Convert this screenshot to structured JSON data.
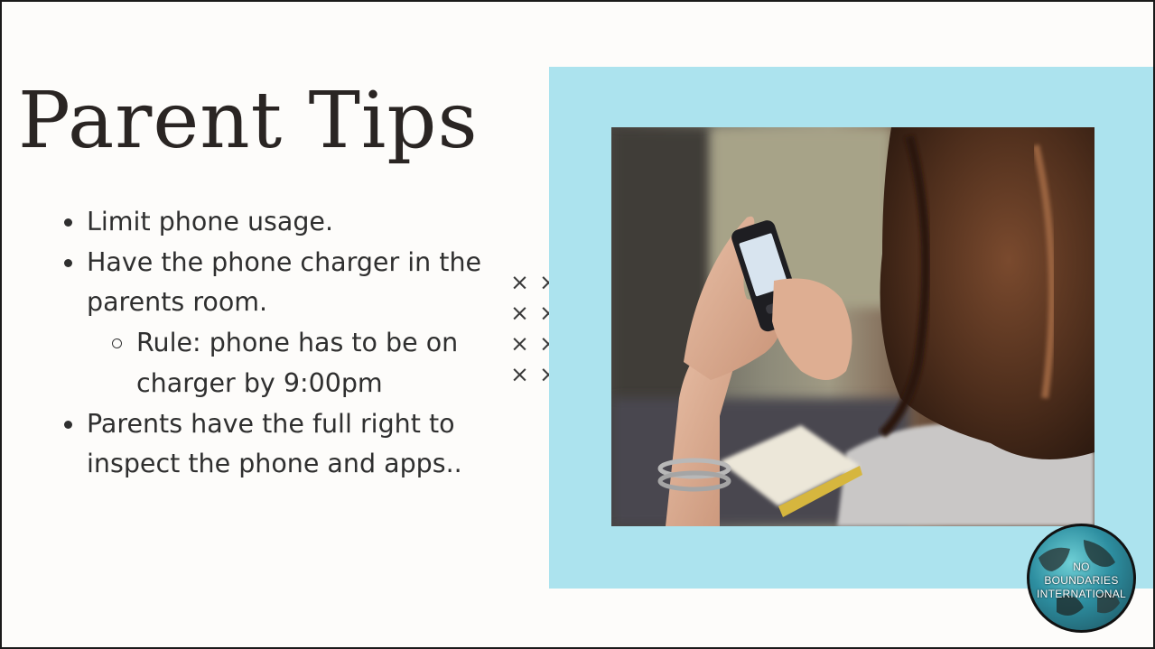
{
  "slide": {
    "title": "Parent Tips",
    "bullets": [
      "Limit phone usage.",
      "Have the phone charger in the parents room."
    ],
    "sub_bullet": "Rule: phone has to be on charger by 9:00pm",
    "last_bullet": "Parents have the full right to inspect the phone and apps..",
    "decoration_glyph": "×",
    "photo_alt": "Person with long curly hair texting on a phone",
    "logo": {
      "lines": [
        "NO",
        "BOUNDARIES",
        "INTERNATIONAL"
      ]
    }
  },
  "colors": {
    "background": "#fdfcfa",
    "accent_frame": "#ace3ee",
    "text": "#2f2f2f",
    "title": "#2a2523"
  }
}
